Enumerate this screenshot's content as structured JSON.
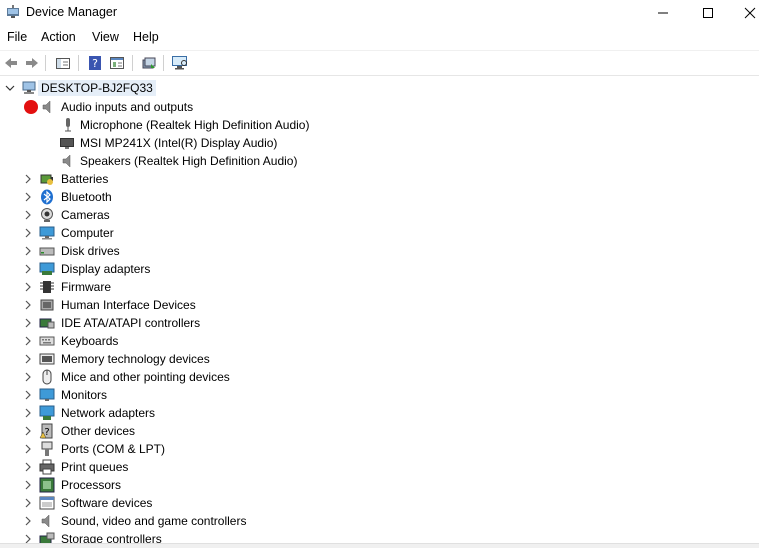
{
  "window": {
    "title": "Device Manager"
  },
  "menu": [
    "File",
    "Action",
    "View",
    "Help"
  ],
  "tree": {
    "root": "DESKTOP-BJ2FQ33",
    "expanded": {
      "label": "Audio inputs and outputs",
      "children": [
        "Microphone (Realtek High Definition Audio)",
        "MSI MP241X (Intel(R) Display Audio)",
        "Speakers (Realtek High Definition Audio)"
      ]
    },
    "categories": [
      "Batteries",
      "Bluetooth",
      "Cameras",
      "Computer",
      "Disk drives",
      "Display adapters",
      "Firmware",
      "Human Interface Devices",
      "IDE ATA/ATAPI controllers",
      "Keyboards",
      "Memory technology devices",
      "Mice and other pointing devices",
      "Monitors",
      "Network adapters",
      "Other devices",
      "Ports (COM & LPT)",
      "Print queues",
      "Processors",
      "Software devices",
      "Sound, video and game controllers",
      "Storage controllers"
    ]
  }
}
